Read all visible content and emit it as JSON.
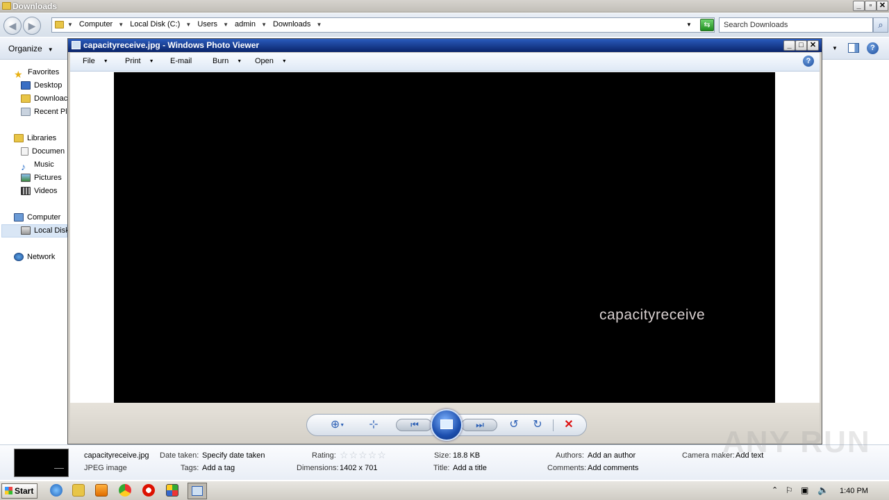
{
  "explorer": {
    "title": "Downloads",
    "breadcrumbs": [
      "Computer",
      "Local Disk (C:)",
      "Users",
      "admin",
      "Downloads"
    ],
    "search_placeholder": "Search Downloads",
    "organize_label": "Organize",
    "nav": {
      "favorites": "Favorites",
      "desktop": "Desktop",
      "downloads": "Downloac",
      "recent": "Recent Pl",
      "libraries": "Libraries",
      "documents": "Documen",
      "music": "Music",
      "pictures": "Pictures",
      "videos": "Videos",
      "computer": "Computer",
      "local_disk": "Local Disk",
      "network": "Network"
    }
  },
  "photo_viewer": {
    "title": "capacityreceive.jpg - Windows Photo Viewer",
    "menu": {
      "file": "File",
      "print": "Print",
      "email": "E-mail",
      "burn": "Burn",
      "open": "Open"
    },
    "image_text": "capacityreceive"
  },
  "details": {
    "filename": "capacityreceive.jpg",
    "filetype": "JPEG image",
    "date_taken_label": "Date taken:",
    "date_taken_value": "Specify date taken",
    "tags_label": "Tags:",
    "tags_value": "Add a tag",
    "rating_label": "Rating:",
    "dimensions_label": "Dimensions:",
    "dimensions_value": "1402 x 701",
    "size_label": "Size:",
    "size_value": "18.8 KB",
    "title_label": "Title:",
    "title_value": "Add a title",
    "authors_label": "Authors:",
    "authors_value": "Add an author",
    "comments_label": "Comments:",
    "comments_value": "Add comments",
    "camera_label": "Camera maker:",
    "camera_value": "Add text"
  },
  "watermark": "ANY RUN",
  "taskbar": {
    "start_label": "Start",
    "clock": "1:40 PM"
  }
}
